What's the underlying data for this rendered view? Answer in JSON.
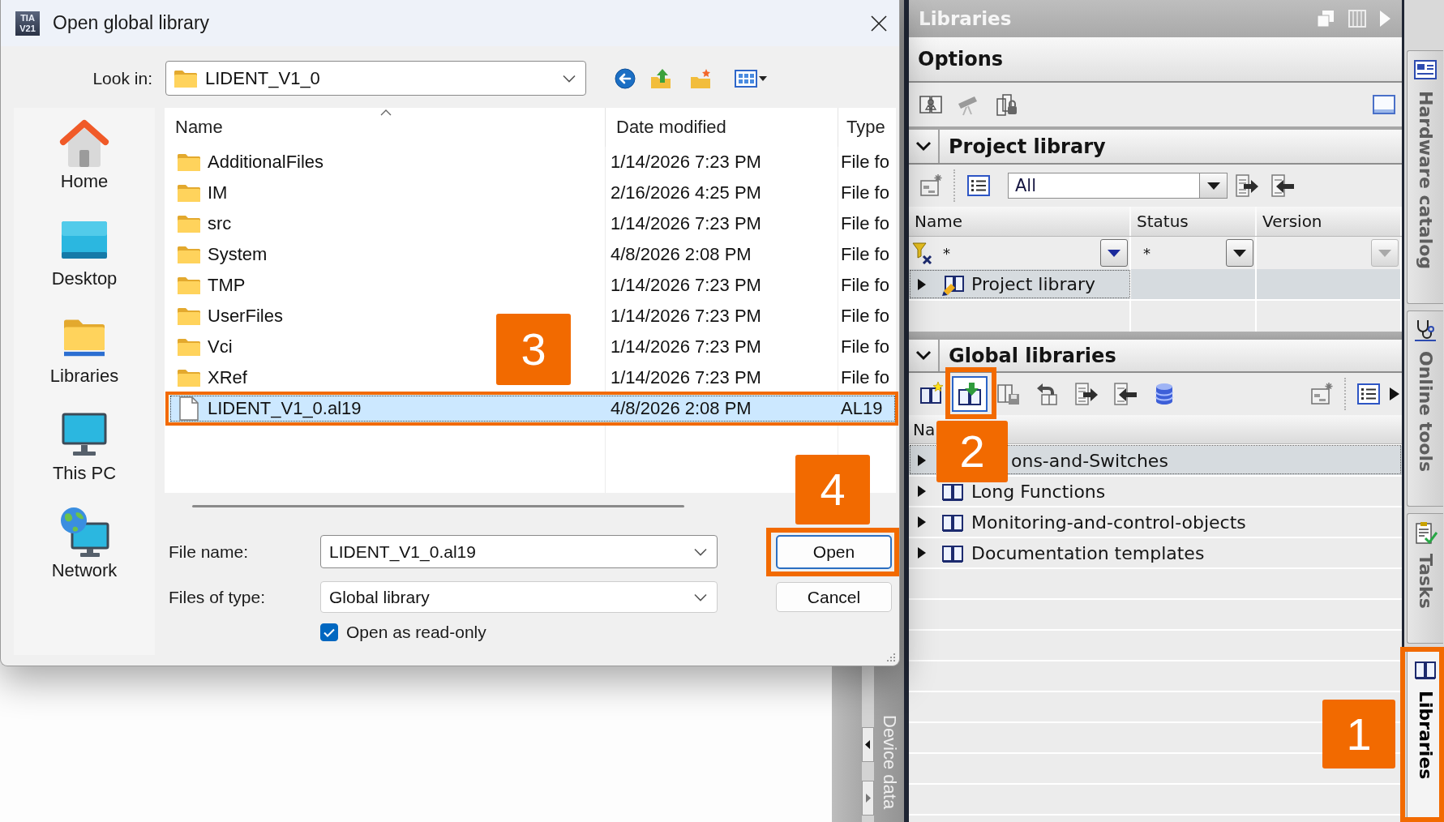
{
  "dialog": {
    "logo_text": "TIA V21",
    "title": "Open global library",
    "look_in": {
      "label": "Look in:",
      "value": "LIDENT_V1_0"
    },
    "places": [
      {
        "label": "Home",
        "kind": "home"
      },
      {
        "label": "Desktop",
        "kind": "desktop"
      },
      {
        "label": "Libraries",
        "kind": "libraries"
      },
      {
        "label": "This PC",
        "kind": "pc"
      },
      {
        "label": "Network",
        "kind": "network"
      }
    ],
    "columns": [
      "Name",
      "Date modified",
      "Type"
    ],
    "files": [
      {
        "name": "AdditionalFiles",
        "date": "1/14/2026 7:23 PM",
        "type": "File fo",
        "kind": "folder",
        "selected": false
      },
      {
        "name": "IM",
        "date": "2/16/2026 4:25 PM",
        "type": "File fo",
        "kind": "folder",
        "selected": false
      },
      {
        "name": "src",
        "date": "1/14/2026 7:23 PM",
        "type": "File fo",
        "kind": "folder",
        "selected": false
      },
      {
        "name": "System",
        "date": "4/8/2026 2:08 PM",
        "type": "File fo",
        "kind": "folder",
        "selected": false
      },
      {
        "name": "TMP",
        "date": "1/14/2026 7:23 PM",
        "type": "File fo",
        "kind": "folder",
        "selected": false
      },
      {
        "name": "UserFiles",
        "date": "1/14/2026 7:23 PM",
        "type": "File fo",
        "kind": "folder",
        "selected": false
      },
      {
        "name": "Vci",
        "date": "1/14/2026 7:23 PM",
        "type": "File fo",
        "kind": "folder",
        "selected": false
      },
      {
        "name": "XRef",
        "date": "1/14/2026 7:23 PM",
        "type": "File fo",
        "kind": "folder",
        "selected": false
      },
      {
        "name": "LIDENT_V1_0.al19",
        "date": "4/8/2026 2:08 PM",
        "type": "AL19",
        "kind": "file",
        "selected": true
      }
    ],
    "file_name": {
      "label": "File name:",
      "value": "LIDENT_V1_0.al19"
    },
    "file_type": {
      "label": "Files of type:",
      "value": "Global library"
    },
    "read_only": {
      "label": "Open as read-only",
      "checked": true
    },
    "buttons": [
      {
        "label": "Open",
        "default": true
      },
      {
        "label": "Cancel",
        "default": false
      }
    ]
  },
  "device_strip": {
    "label": "Device data"
  },
  "libraries": {
    "title": "Libraries",
    "options": {
      "title": "Options"
    },
    "project_library": {
      "title": "Project library",
      "expanded": true,
      "filter": "All",
      "columns": [
        "Name",
        "Status",
        "Version"
      ],
      "filters": [
        {
          "value": "*",
          "disabled": false
        },
        {
          "value": "*",
          "disabled": false
        },
        {
          "disabled": true
        }
      ],
      "rows": [
        {
          "label": "Project library",
          "expanded": false,
          "selected": true
        }
      ]
    },
    "global_libraries": {
      "title": "Global libraries",
      "expanded": true,
      "toolbar": [
        {
          "kind": "new",
          "selected": false
        },
        {
          "kind": "open",
          "selected": true
        },
        {
          "kind": "save",
          "selected": false
        },
        {
          "kind": "revert",
          "selected": false
        },
        {
          "kind": "export",
          "selected": false
        },
        {
          "kind": "import",
          "selected": false
        },
        {
          "kind": "database",
          "selected": false
        },
        {
          "kind": "properties",
          "selected": false
        },
        {
          "kind": "details",
          "selected": false
        }
      ],
      "column": "Na",
      "rows": [
        {
          "label": "ons-and-Switches",
          "expanded": false,
          "selected": true
        },
        {
          "label": "Long Functions",
          "expanded": false,
          "selected": false
        },
        {
          "label": "Monitoring-and-control-objects",
          "expanded": false,
          "selected": false
        },
        {
          "label": "Documentation templates",
          "expanded": false,
          "selected": false
        }
      ]
    }
  },
  "side_tabs": [
    {
      "label": "Hardware catalog",
      "kind": "catalog",
      "selected": false
    },
    {
      "label": "Online tools",
      "kind": "online",
      "selected": false
    },
    {
      "label": "Tasks",
      "kind": "tasks",
      "selected": false
    },
    {
      "label": "Libraries",
      "kind": "libraries",
      "selected": true
    }
  ],
  "callouts": [
    {
      "label": "3",
      "kind": "file"
    },
    {
      "label": "2",
      "kind": "toolbar"
    },
    {
      "label": "4",
      "kind": "button"
    },
    {
      "label": "1",
      "kind": "tab"
    }
  ]
}
